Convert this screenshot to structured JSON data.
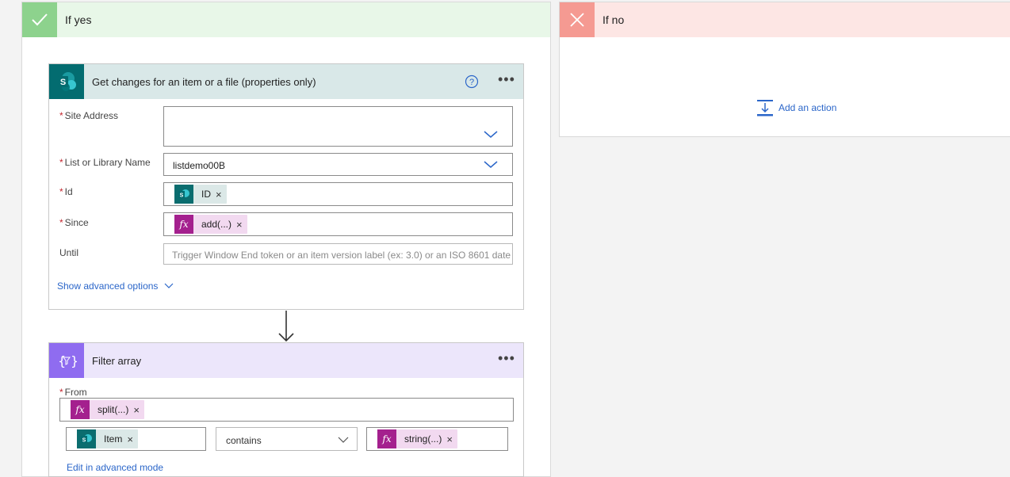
{
  "yes_branch": {
    "title": "If yes"
  },
  "no_branch": {
    "title": "If no",
    "add_action_label": "Add an action"
  },
  "card1": {
    "title": "Get changes for an item or a file (properties only)",
    "fields": {
      "site_address": {
        "label": "Site Address",
        "required": true,
        "value": "",
        "control": "dropdown"
      },
      "list_name": {
        "label": "List or Library Name",
        "required": true,
        "value": "listdemo00B",
        "control": "dropdown"
      },
      "id": {
        "label": "Id",
        "required": true,
        "token": "ID",
        "token_type": "sharepoint"
      },
      "since": {
        "label": "Since",
        "required": true,
        "token": "add(...)",
        "token_type": "expression"
      },
      "until": {
        "label": "Until",
        "required": false,
        "placeholder": "Trigger Window End token or an item version label (ex: 3.0) or an ISO 8601 date"
      }
    },
    "show_advanced_label": "Show advanced options"
  },
  "card2": {
    "title": "Filter array",
    "from": {
      "label": "From",
      "required": true,
      "token": "split(...)",
      "token_type": "expression"
    },
    "condition": {
      "left_token": "Item",
      "left_token_type": "sharepoint",
      "operator": "contains",
      "right_token": "string(...)",
      "right_token_type": "expression"
    },
    "edit_advanced_label": "Edit in advanced mode"
  },
  "icons": {
    "yes": "checkmark-icon",
    "no": "close-icon",
    "sharepoint": "sharepoint-icon",
    "expression": "fx-icon",
    "filter": "filter-array-icon",
    "help": "help-icon",
    "more": "more-options-icon"
  },
  "colors": {
    "yes_accent": "#8dd28d",
    "no_accent": "#f59a92",
    "sharepoint": "#036c70",
    "expression": "#a4208e",
    "filter": "#8f6cf0",
    "link": "#2b66c9"
  }
}
